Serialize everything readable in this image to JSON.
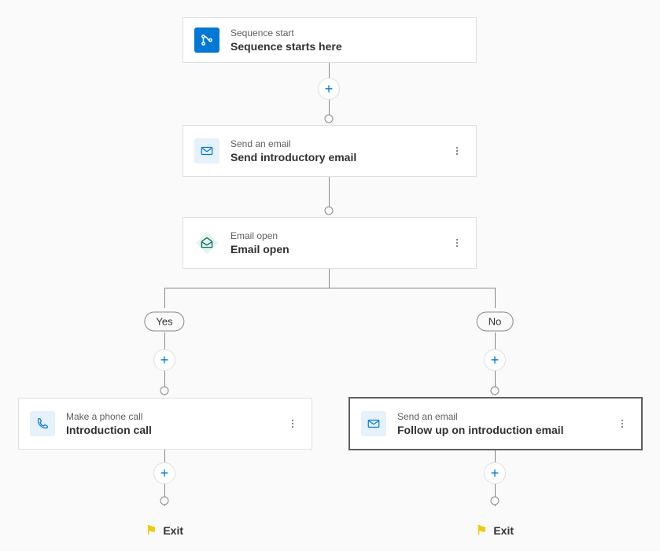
{
  "nodes": {
    "start": {
      "type": "Sequence start",
      "title": "Sequence starts here"
    },
    "email1": {
      "type": "Send an email",
      "title": "Send introductory email"
    },
    "cond": {
      "type": "Email open",
      "title": "Email open"
    },
    "call": {
      "type": "Make a phone call",
      "title": "Introduction call"
    },
    "email2": {
      "type": "Send an email",
      "title": "Follow up on introduction email"
    }
  },
  "branches": {
    "yes": "Yes",
    "no": "No"
  },
  "exit_label": "Exit"
}
